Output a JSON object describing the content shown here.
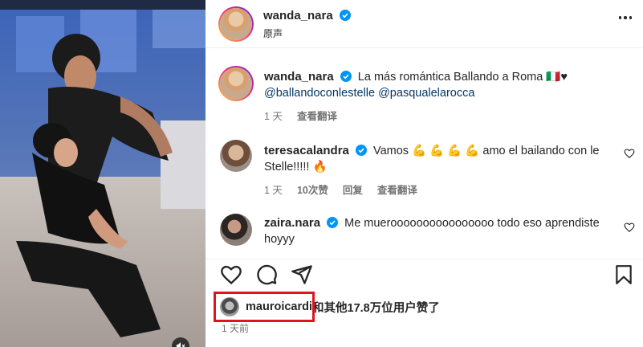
{
  "colors": {
    "verified": "#0095f6",
    "text": "#262626",
    "muted": "#737373",
    "link": "#00376b",
    "highlight": "#e0141e",
    "emoji_flex": "#f4b400",
    "emoji_fire": "#f57c00"
  },
  "header": {
    "username": "wanda_nara",
    "subtitle": "原声"
  },
  "caption": {
    "username": "wanda_nara",
    "text": "La más romántica Ballando a Roma 🇮🇹♥",
    "mentions": "@ballandoconlestelle @pasqualelarocca",
    "time": "1 天",
    "translate": "查看翻译"
  },
  "comments": [
    {
      "username": "teresacalandra",
      "text_line1": "Vamos 💪 💪 💪 💪 amo el bailando con le",
      "text_line2": "Stelle!!!!! 🔥",
      "time": "1 天",
      "likes": "10次赞",
      "reply": "回复",
      "translate": "查看翻译"
    },
    {
      "username": "zaira.nara",
      "text_line1": "Me mueroooooooooooooooo todo eso aprendiste",
      "text_line2": "hoyyy"
    }
  ],
  "actions": {
    "like_icon": "heart-icon",
    "comment_icon": "comment-icon",
    "share_icon": "send-icon",
    "save_icon": "bookmark-icon"
  },
  "likes": {
    "user": "mauroicardi",
    "rest": "和其他17.8万位用户赞了"
  },
  "post_time": "1 天前"
}
